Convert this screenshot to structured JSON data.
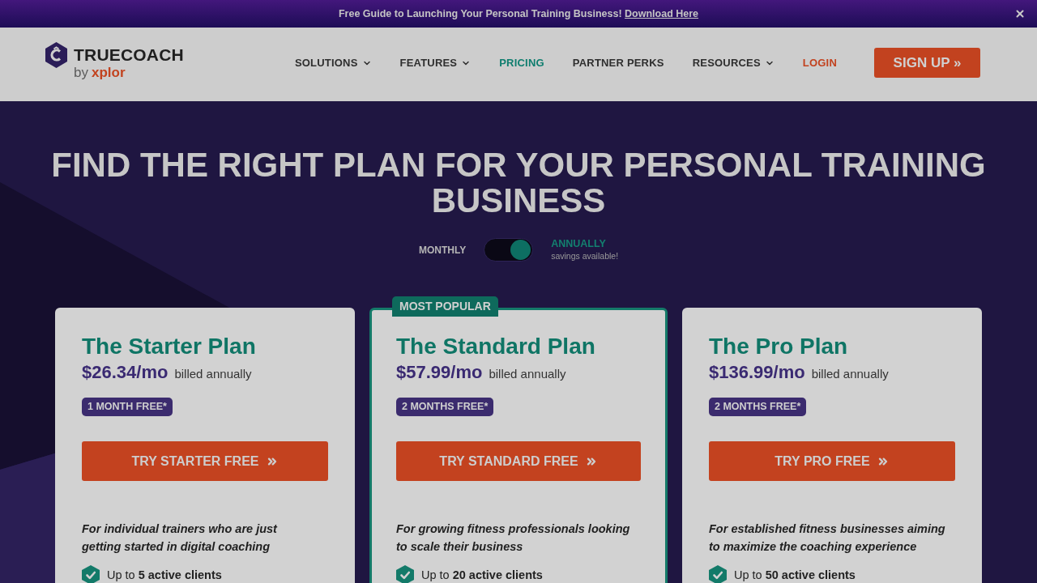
{
  "banner": {
    "text": "Free Guide to Launching Your Personal Training Business!",
    "link": "Download Here"
  },
  "nav": {
    "logo": {
      "name": "TRUECOACH",
      "by": "by",
      "partner": "xplor"
    },
    "items": [
      {
        "label": "SOLUTIONS",
        "kind": "menu",
        "selected": false
      },
      {
        "label": "FEATURES",
        "kind": "menu",
        "selected": false
      },
      {
        "label": "PRICING",
        "kind": "link",
        "selected": true
      },
      {
        "label": "PARTNER PERKS",
        "kind": "link",
        "selected": false
      },
      {
        "label": "RESOURCES",
        "kind": "menu",
        "selected": false
      },
      {
        "label": "LOGIN",
        "kind": "login",
        "selected": false
      }
    ],
    "signup": "SIGN UP »"
  },
  "hero": {
    "title": "FIND THE RIGHT PLAN FOR YOUR PERSONAL TRAINING BUSINESS"
  },
  "billing": {
    "monthly": "MONTHLY",
    "annually": "ANNUALLY",
    "note": "savings available!",
    "annual": true
  },
  "plans": [
    {
      "name": "The Starter Plan",
      "price": "$26.34/mo",
      "billing": "billed annually",
      "offer": "1 MONTH FREE*",
      "cta": "TRY STARTER FREE",
      "description": "For individual trainers who are just getting started in digital coaching",
      "features": [
        "Up to **5 active clients**"
      ],
      "featured": false
    },
    {
      "name": "The Standard Plan",
      "price": "$57.99/mo",
      "billing": "billed annually",
      "offer": "2 MONTHS FREE*",
      "cta": "TRY STANDARD FREE",
      "description": "For growing fitness professionals looking to scale their business",
      "features": [
        "Up to **20 active clients**"
      ],
      "featured": true,
      "ribbon": "MOST POPULAR"
    },
    {
      "name": "The Pro Plan",
      "price": "$136.99/mo",
      "billing": "billed annually",
      "offer": "2 MONTHS FREE*",
      "cta": "TRY PRO FREE",
      "description": "For established fitness businesses aiming to maximize the coaching experience",
      "features": [
        "Up to **50 active clients**"
      ],
      "featured": false
    }
  ]
}
